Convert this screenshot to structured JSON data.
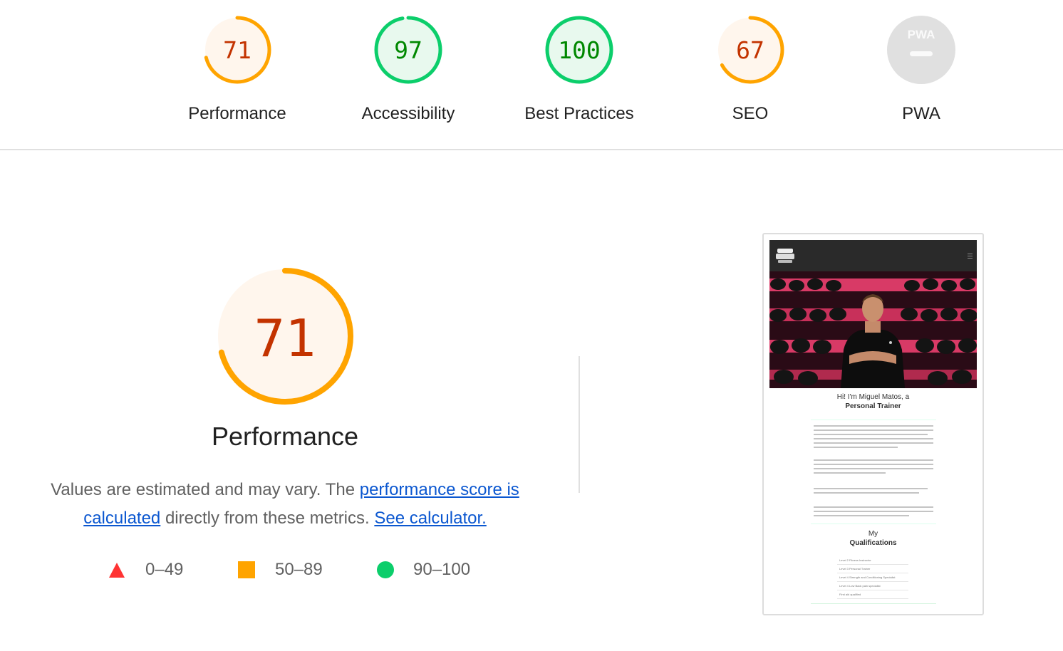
{
  "categories": [
    {
      "key": "performance",
      "score": "71",
      "label": "Performance",
      "fraction": 0.71,
      "color": "#ffa400",
      "text_color": "#c33300",
      "bg": "#fff6ed"
    },
    {
      "key": "accessibility",
      "score": "97",
      "label": "Accessibility",
      "fraction": 0.97,
      "color": "#0cce6b",
      "text_color": "#008800",
      "bg": "#e8f9ee"
    },
    {
      "key": "best-practices",
      "score": "100",
      "label": "Best Practices",
      "fraction": 1.0,
      "color": "#0cce6b",
      "text_color": "#008800",
      "bg": "#e8f9ee"
    },
    {
      "key": "seo",
      "score": "67",
      "label": "SEO",
      "fraction": 0.67,
      "color": "#ffa400",
      "text_color": "#c33300",
      "bg": "#fff6ed"
    },
    {
      "key": "pwa",
      "score": "",
      "label": "PWA",
      "badge": "PWA",
      "color": "#cccccc",
      "bg": "#e0e0e0"
    }
  ],
  "main": {
    "score": "71",
    "fraction": 0.71,
    "title": "Performance",
    "desc_before": "Values are estimated and may vary. The ",
    "link1": "performance score is calculated",
    "desc_middle": " directly from these metrics. ",
    "link2": "See calculator."
  },
  "legend": [
    {
      "shape": "triangle",
      "range": "0–49",
      "color": "#ff3333"
    },
    {
      "shape": "square",
      "range": "50–89",
      "color": "#ffa400"
    },
    {
      "shape": "circle",
      "range": "90–100",
      "color": "#0cce6b"
    }
  ],
  "screenshot": {
    "heading_line1": "Hi! I'm Miguel Matos, a",
    "heading_line2": "Personal Trainer",
    "q_line1": "My",
    "q_line2": "Qualifications",
    "qualifications": [
      "Level 2 Fitness Instructor",
      "Level 3 Personal Trainer",
      "Level 4 Strength and Conditioning Specialist",
      "Level 4 Low Back pain specialist",
      "First aid qualified"
    ]
  }
}
